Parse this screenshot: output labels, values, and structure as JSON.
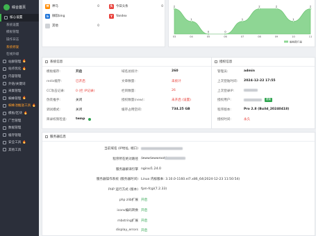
{
  "sidebar": {
    "title": "综合首页",
    "items": [
      {
        "label": "核心设置",
        "type": "section",
        "active": true
      },
      {
        "label": "系统设置",
        "type": "sub"
      },
      {
        "label": "模板管理",
        "type": "sub"
      },
      {
        "label": "操作日志",
        "type": "sub"
      },
      {
        "label": "系统修复",
        "type": "sub",
        "hot": true
      },
      {
        "label": "在线升级",
        "type": "sub"
      },
      {
        "label": "站群管理",
        "type": "section",
        "flame": true
      },
      {
        "label": "站点优化",
        "type": "section",
        "flame": true
      },
      {
        "label": "内容管理",
        "type": "section"
      },
      {
        "label": "外链/关键词",
        "type": "section"
      },
      {
        "label": "采集管理",
        "type": "section"
      },
      {
        "label": "蜘蛛管理",
        "type": "section",
        "flame": true
      },
      {
        "label": "蜘蛛池推送工具",
        "type": "section",
        "flame": true,
        "hot": true
      },
      {
        "label": "模板/区块",
        "type": "section",
        "flame": true
      },
      {
        "label": "广告管理",
        "type": "section"
      },
      {
        "label": "数据管理",
        "type": "section"
      },
      {
        "label": "缓存管理",
        "type": "section"
      },
      {
        "label": "安全工具",
        "type": "section",
        "flame": true
      },
      {
        "label": "其他工具",
        "type": "section"
      }
    ]
  },
  "engines": [
    {
      "name": "神马",
      "count": "0",
      "color": "#ff8a00",
      "icon": "神"
    },
    {
      "name": "今日头条",
      "count": "0",
      "color": "#e8413b",
      "icon": "头"
    },
    {
      "name": "微软bing",
      "count": "",
      "color": "#1e74d9",
      "icon": "b"
    },
    {
      "name": "Yandex",
      "count": "",
      "color": "#e8413b",
      "icon": "Y"
    },
    {
      "name": "其他",
      "count": "0",
      "color": "#cfd2d6",
      "icon": ""
    }
  ],
  "chart_data": {
    "type": "area",
    "categories": [
      "03",
      "04",
      "05",
      "06",
      "07",
      "08",
      "09",
      "10",
      "11"
    ],
    "values": [
      2,
      1,
      0,
      0,
      1,
      2,
      2,
      1,
      2
    ],
    "point_labels": [
      "2",
      "1",
      "0",
      "0",
      "1",
      "2",
      "2",
      "1",
      "2"
    ],
    "legend": "蜘蛛爬行量",
    "legend_position": "bottom-right",
    "color": "#8ed694",
    "ylim": [
      0,
      2.2
    ]
  },
  "system_info": {
    "title": "系统信息",
    "rows": [
      {
        "l1": "模板缓存:",
        "v1": "开启",
        "l2": "域名总统计:",
        "v2": "260"
      },
      {
        "l1": "redis缓存:",
        "v1": "已开启",
        "l2": "文章数量:",
        "v2": "未统计"
      },
      {
        "l1": "CC攻击记录:",
        "v1": "0 (拦 IP记录)",
        "l2": "栏目数量:",
        "v2": "26"
      },
      {
        "l1": "伪装推手:",
        "v1": "关闭",
        "l2": "授权数量(new):",
        "v2": "未开启 (设置)"
      },
      {
        "l1": "调试模式:",
        "v1": "关闭",
        "l2": "缓存占用空间:",
        "v2": "734.25 GB"
      },
      {
        "l1": "目录权限检查:",
        "v1": "temp",
        "l2": "",
        "v2": ""
      }
    ]
  },
  "license": {
    "title": "授权信息",
    "rows": [
      {
        "l": "管理员:",
        "v": "admin"
      },
      {
        "l": "上次登陆时间:",
        "v": "2024-12-22 17:55"
      },
      {
        "l": "上次登录IP:",
        "v": ""
      },
      {
        "l": "授权用户:",
        "v": "",
        "btn": "更新"
      },
      {
        "l": "程序版本:",
        "v": "Pro 2.8 (Build_20240418)"
      },
      {
        "l": "授权时间:",
        "v": "永久"
      }
    ]
  },
  "server": {
    "title": "服务器信息",
    "rows": [
      {
        "k": "当前域名 (IP地址, 端口)",
        "v": ""
      },
      {
        "k": "程序所在绝对路径",
        "v": "/www/wwwroot/"
      },
      {
        "k": "服务器解译引擎",
        "v": "nginx/1.24.0"
      },
      {
        "k": "服务器操作系统 (服务器时间)",
        "v": "Linux 内核版本: 3.10.0-1160.el7.x86_64(2024-12-23 11:50:54)"
      },
      {
        "k": "PHP 运行方式 (版本)",
        "v": "fpm-fcgi(7.2.33)"
      },
      {
        "k": "php zlib扩展",
        "v": "开启",
        "ok": true
      },
      {
        "k": "iconv编码转换",
        "v": "开启",
        "ok": true
      },
      {
        "k": "mbstring扩展",
        "v": "开启",
        "ok": true
      },
      {
        "k": "display_errors",
        "v": "开启",
        "ok": true
      }
    ]
  }
}
